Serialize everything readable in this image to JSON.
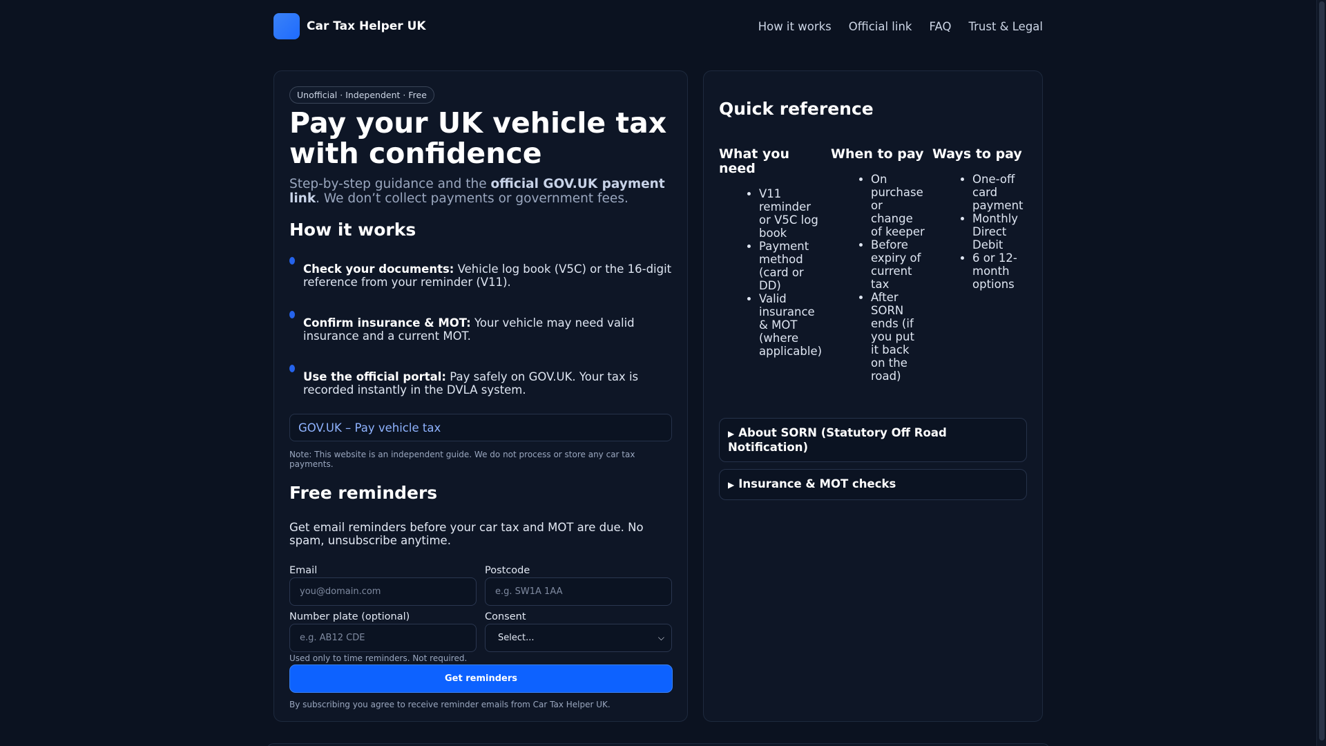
{
  "header": {
    "brand": "Car Tax Helper UK",
    "nav": [
      "How it works",
      "Official link",
      "FAQ",
      "Trust & Legal"
    ]
  },
  "hero": {
    "badge": "Unofficial · Independent · Free",
    "title": "Pay your UK vehicle tax with confidence",
    "subtitle_pre": "Step-by-step guidance and the ",
    "subtitle_bold": "official GOV.UK payment link",
    "subtitle_post": ". We don’t collect payments or government fees."
  },
  "how": {
    "title": "How it works",
    "steps": [
      {
        "bold": "Check your documents:",
        "text": " Vehicle log book (V5C) or the 16-digit reference from your reminder (V11)."
      },
      {
        "bold": "Confirm insurance & MOT:",
        "text": " Your vehicle may need valid insurance and a current MOT."
      },
      {
        "bold": "Use the official portal:",
        "text": " Pay safely on GOV.UK. Your tax is recorded instantly in the DVLA system."
      }
    ],
    "link_label": "GOV.UK – Pay vehicle tax",
    "note": "Note: This website is an independent guide. We do not process or store any car tax payments."
  },
  "reminders": {
    "title": "Free reminders",
    "text": "Get email reminders before your car tax and MOT are due. No spam, unsubscribe anytime.",
    "email_label": "Email",
    "email_placeholder": "you@domain.com",
    "postcode_label": "Postcode",
    "postcode_placeholder": "e.g. SW1A 1AA",
    "plate_label": "Number plate (optional)",
    "plate_placeholder": "e.g. AB12 CDE",
    "consent_label": "Consent",
    "consent_value": "Select...",
    "helper": "Used only to time reminders. Not required.",
    "button": "Get reminders",
    "footnote": "By subscribing you agree to receive reminder emails from Car Tax Helper UK."
  },
  "quick": {
    "title": "Quick reference",
    "columns": [
      {
        "title": "What you need",
        "items": [
          "V11 reminder or V5C log book",
          "Payment method (card or DD)",
          "Valid insurance & MOT (where applicable)"
        ]
      },
      {
        "title": "When to pay",
        "items": [
          "On purchase or change of keeper",
          "Before expiry of current tax",
          "After SORN ends (if you put it back on the road)"
        ]
      },
      {
        "title": "Ways to pay",
        "items": [
          "One-off card payment",
          "Monthly Direct Debit",
          "6 or 12-month options"
        ]
      }
    ],
    "details": [
      "About SORN (Statutory Off Road Notification)",
      "Insurance & MOT checks"
    ]
  }
}
